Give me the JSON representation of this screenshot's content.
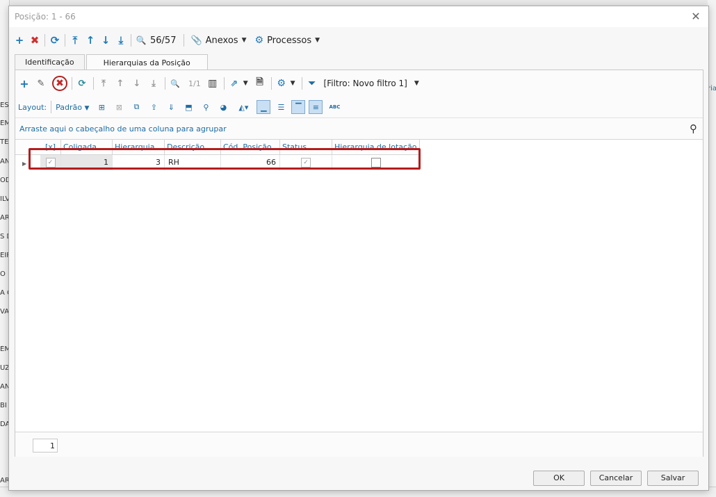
{
  "background": {
    "left_fragments": [
      "ES",
      "ÉM",
      "TES",
      "AN",
      "OD",
      "ILV",
      "ÁRI",
      "S D",
      "EIR",
      "O E",
      "A C",
      "VA",
      "ÉM",
      "UZ",
      "AN",
      "BI",
      "DA",
      "ARI"
    ],
    "right_fragment": "ria"
  },
  "window": {
    "title": "Posição: 1 - 66",
    "close_glyph": "✕"
  },
  "main_toolbar": {
    "icons": {
      "add": "+",
      "delete": "✖",
      "refresh": "⟳",
      "first": "⤒",
      "prev": "↑",
      "next": "↓",
      "last": "⤓",
      "search": "🔍"
    },
    "record_counter": "56/57",
    "attachments_label": "Anexos",
    "processes_label": "Processos"
  },
  "tabs": [
    {
      "label": "Identificação"
    },
    {
      "label": "Hierarquias da Posição"
    }
  ],
  "sub_toolbar": {
    "pager": "1/1",
    "filter_label": "[Filtro: Novo filtro 1]"
  },
  "layout_bar": {
    "label": "Layout:",
    "value": "Padrão",
    "abc_glyph": "ABC"
  },
  "group_hint": "Arraste aqui o cabeçalho de uma coluna para agrupar",
  "grid": {
    "columns": [
      "[x]",
      "Coligada",
      "Hierarquia",
      "Descrição",
      "Cód. Posição",
      "Status",
      "Hierarquia de lotação"
    ],
    "rows": [
      {
        "selected": "✓",
        "coligada": "1",
        "hierarquia": "3",
        "descricao": "RH",
        "cod_posicao": "66",
        "status": "✓",
        "lotacao": ""
      }
    ]
  },
  "footer": {
    "record_count": "1"
  },
  "buttons": {
    "ok": "OK",
    "cancel": "Cancelar",
    "save": "Salvar"
  }
}
